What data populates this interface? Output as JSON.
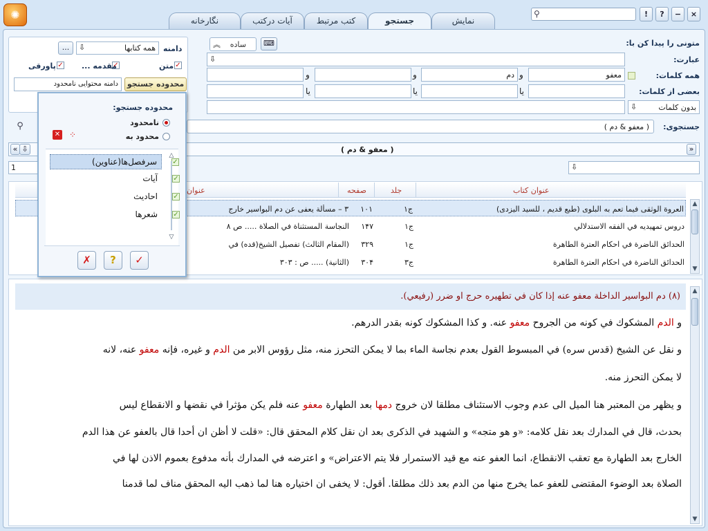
{
  "window": {
    "buttons": [
      "×",
      "−",
      "?",
      "!"
    ],
    "search_placeholder": ""
  },
  "tabs": [
    {
      "label": "نمایش",
      "active": false
    },
    {
      "label": "جستجو",
      "active": true
    },
    {
      "label": "کتب مرتبط",
      "active": false
    },
    {
      "label": "آیات درکتب",
      "active": false
    },
    {
      "label": "نگارخانه",
      "active": false
    }
  ],
  "search": {
    "heading": "متونی را پیدا کن با:",
    "phrase_label": "عبارت:",
    "all_words_label": "همه کلمات:",
    "some_words_label": "بعضی از کلمات:",
    "without_words": "بدون کلمات",
    "mode": "ساده",
    "and_word": "و",
    "or_word": "یا",
    "all_words_values": [
      "معفو",
      "دم",
      "",
      ""
    ],
    "query_label": "جستجوی:",
    "query_value": "( معفو & دم )",
    "result_query": "( معفو & دم )",
    "page_no": "1"
  },
  "scope": {
    "label": "دامنه",
    "value": "همه کتابها",
    "more": "...",
    "options": [
      {
        "label": "متن",
        "checked": true
      },
      {
        "label": "مقدمه ...",
        "checked": true
      },
      {
        "label": "پاورقی",
        "checked": true
      }
    ],
    "limit_button": "محدوده جستجو",
    "limit_value": "دامنه محتوایی نامحدود"
  },
  "popup": {
    "title": "محدوده جستجو:",
    "radios": [
      {
        "label": "نامحدود",
        "selected": true
      },
      {
        "label": "محدود به",
        "selected": false
      }
    ],
    "items": [
      {
        "label": "سرفصل‌ها(عناوین)",
        "checked": true,
        "selected": true
      },
      {
        "label": "آیات",
        "checked": true,
        "selected": false
      },
      {
        "label": "احادیث",
        "checked": true,
        "selected": false
      },
      {
        "label": "شعرها",
        "checked": true,
        "selected": false
      }
    ],
    "actions": [
      "✓",
      "?",
      "✗"
    ]
  },
  "results": {
    "headers": {
      "book": "عنوان کتاب",
      "volume": "جلد",
      "page": "صفحه",
      "title": "عنوان"
    },
    "rows": [
      {
        "book": "العروة الوثقى فيما تعم به البلوى (طبع قديم ، للسيد اليزدى)",
        "volume": "ج۱",
        "page": "۱۰۱",
        "title": "۳ – مسألة يعفى عن دم البواسير خارج",
        "selected": true
      },
      {
        "book": "دروس تمهيديه في الفقه الاستدلالي",
        "volume": "ج۱",
        "page": "۱۴۷",
        "title": "النجاسة المستثناة في الصلاة ..... ص ۸",
        "selected": false
      },
      {
        "book": "الحدائق الناضرة في احكام العترة الطاهرة",
        "volume": "ج۱",
        "page": "۳۲۹",
        "title": "(المقام الثالث) تفصيل الشيخ(قده) في",
        "selected": false
      },
      {
        "book": "الحدائق الناضرة في احكام العترة الطاهرة",
        "volume": "ج۳",
        "page": "۳۰۴",
        "title": "(الثانية) ..... ص : ۳۰۳",
        "selected": false
      }
    ]
  },
  "content": {
    "heading": "(۸) دم البواسير الداخلة معفو عنه إذا كان في تطهيره حرج او ضرر (رفيعي).",
    "lines": [
      [
        {
          "t": "و "
        },
        {
          "t": "الدم",
          "h": true
        },
        {
          "t": " المشكوك في كونه من الجروح "
        },
        {
          "t": "معفو",
          "h": true
        },
        {
          "t": " عنه. و كذا المشكوك كونه بقدر الدرهم."
        }
      ],
      [
        {
          "t": "و نقل عن الشيخ (قدس سره) في المبسوط القول بعدم نجاسة الماء بما لا يمكن التحرز منه، مثل رؤوس الابر من "
        },
        {
          "t": "الدم",
          "h": true
        },
        {
          "t": " و غيره، فإنه "
        },
        {
          "t": "معفو",
          "h": true
        },
        {
          "t": " عنه، لانه"
        }
      ],
      [
        {
          "t": "لا يمكن التحرز منه."
        }
      ],
      [
        {
          "t": "و يظهر من المعتبر هنا الميل الى عدم وجوب الاستئناف مطلقا لان خروج "
        },
        {
          "t": "دمها",
          "h": true
        },
        {
          "t": " بعد الطهارة "
        },
        {
          "t": "معفو",
          "h": true
        },
        {
          "t": " عنه فلم يكن مؤثرا في نقضها و الانقطاع ليس"
        }
      ],
      [
        {
          "t": "بحدث، قال في المدارك بعد نقل كلامه: «و هو متجه» و الشهيد في الذكرى بعد ان نقل كلام المحقق قال: «قلت لا أظن ان أحدا قال بالعفو عن هذا الدم"
        }
      ],
      [
        {
          "t": "الخارج بعد الطهارة مع تعقب الانقطاع، انما العفو عنه مع قيد الاستمرار فلا يتم الاعتراض» و اعترضه في المدارك بأنه مدفوع بعموم الاذن لها في"
        }
      ],
      [
        {
          "t": "الصلاة بعد الوضوء المقتضى للعفو عما يخرج منها من الدم بعد ذلك مطلقا. أقول: لا يخفى ان اختياره هنا لما ذهب اليه المحقق مناف لما قدمنا"
        }
      ]
    ]
  }
}
